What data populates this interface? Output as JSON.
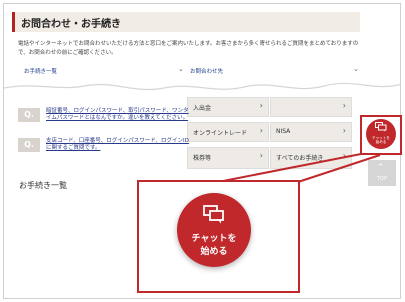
{
  "header": {
    "title": "お問合わせ・お手続き"
  },
  "intro": {
    "text": "電話やインターネットでお問合わせいただける方法と窓口をご案内いたします。お客さまから多く寄せられるご質問をまとめておりますので、お問合わせの前にご確認ください。"
  },
  "links": {
    "procedures": "お手続き一覧",
    "contact": "お問合わせ先"
  },
  "faq": [
    {
      "badge": "Q.",
      "text": "暗証番号、ログインパスワード、取引パスワード、ワンタイムパスワードとはなんですか。違いを教えてください。"
    },
    {
      "badge": "Q.",
      "text": "支店コード、口座番号、ログインパスワード、ログインIDに関するご質問です。"
    }
  ],
  "grid": {
    "deposit": "入出金",
    "online_trade": "オンライントレード",
    "nisa": "NISA",
    "stock": "株券等",
    "all_procedures": "すべてのお手続き"
  },
  "section": {
    "procedures_title": "お手続き一覧"
  },
  "chat": {
    "line1": "チャットを",
    "line2": "始める",
    "small": "チャットを始める"
  },
  "top_button": {
    "label": "TOP"
  },
  "colors": {
    "accent": "#c0282b",
    "header_bg": "#f1ece6",
    "cell_bg": "#eeeae5"
  }
}
